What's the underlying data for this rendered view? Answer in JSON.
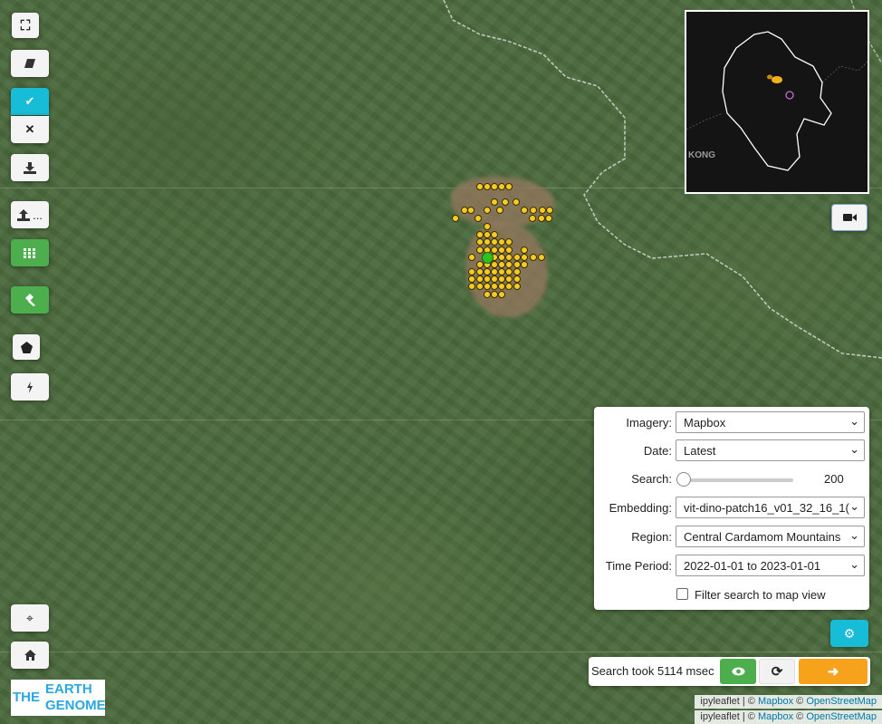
{
  "map": {
    "controls": {
      "fullscreen_icon": "expand-icon",
      "erase_icon": "eraser-icon",
      "confirm_icon": "check-icon",
      "cancel_icon": "x-icon",
      "download_icon": "download-icon",
      "upload_icon": "upload-icon",
      "upload_suffix": "...",
      "grid_icon": "grid-icon",
      "tool_icon": "gavel-icon",
      "polygon_icon": "pentagon-icon",
      "lightning_icon": "bolt-icon",
      "locate_icon": "crosshair-icon",
      "home_icon": "home-icon",
      "camera_icon": "video-camera-icon",
      "settings_icon": "gear-icon"
    },
    "minimap": {
      "label": "KONG"
    }
  },
  "panel": {
    "imagery": {
      "label": "Imagery:",
      "value": "Mapbox"
    },
    "date": {
      "label": "Date:",
      "value": "Latest"
    },
    "search": {
      "label": "Search:",
      "value": "200"
    },
    "embedding": {
      "label": "Embedding:",
      "value": "vit-dino-patch16_v01_32_16_1("
    },
    "region": {
      "label": "Region:",
      "value": "Central Cardamom Mountains"
    },
    "time_period": {
      "label": "Time Period:",
      "value": "2022-01-01 to 2023-01-01"
    },
    "filter": {
      "label": "Filter search to map view",
      "checked": false
    }
  },
  "status": {
    "text": "Search took 5114 msec",
    "view_icon": "eye-icon",
    "refresh_icon": "refresh-icon",
    "next_icon": "arrow-right-icon"
  },
  "attribution": {
    "prefix": "ipyleaflet | ©",
    "mapbox": "Mapbox",
    "sep": "©",
    "osm": "OpenStreetMap"
  },
  "logo": {
    "line1": "THE",
    "line2": "EARTH",
    "line3": "GENOME"
  },
  "colors": {
    "cyan": "#17bcd6",
    "green": "#4cae4c",
    "orange": "#f7a21b",
    "dot_yellow": "#f2cc22",
    "selected_green": "#2ec21f"
  }
}
